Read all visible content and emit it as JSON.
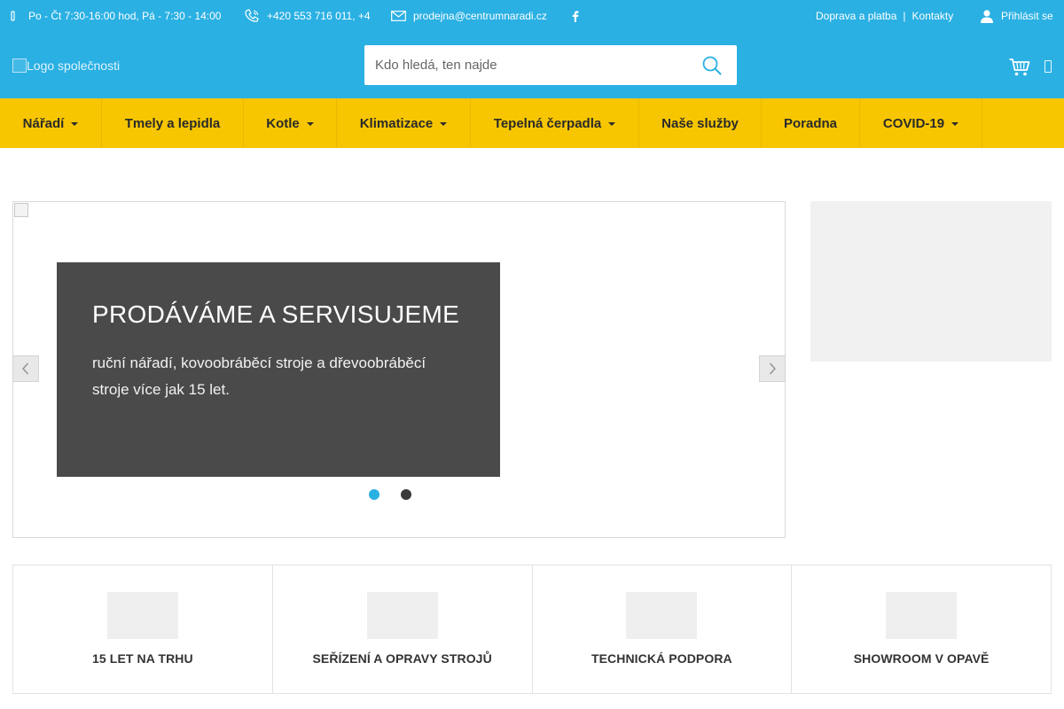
{
  "topbar": {
    "hours": "Po - Čt 7:30-16:00 hod, Pá - 7:30 - 14:00",
    "phone": "+420 553 716 011, +4",
    "email": "prodejna@centrumnaradi.cz",
    "links": {
      "shipping": "Doprava a platba",
      "separator": "|",
      "contacts": "Kontakty"
    },
    "login": "Přihlásit se"
  },
  "header": {
    "logo_alt": "Logo společnosti",
    "search": {
      "placeholder": "Kdo hledá, ten najde",
      "value": ""
    }
  },
  "nav": {
    "items": [
      {
        "label": "Nářadí",
        "dropdown": true
      },
      {
        "label": "Tmely a lepidla",
        "dropdown": false
      },
      {
        "label": "Kotle",
        "dropdown": true
      },
      {
        "label": "Klimatizace",
        "dropdown": true
      },
      {
        "label": "Tepelná čerpadla",
        "dropdown": true
      },
      {
        "label": "Naše služby",
        "dropdown": false
      },
      {
        "label": "Poradna",
        "dropdown": false
      },
      {
        "label": "COVID-19",
        "dropdown": true
      }
    ]
  },
  "slider": {
    "title": "PRODÁVÁME A SERVISUJEME",
    "text": "ruční nářadí, kovoobráběcí stroje a dřevoobráběcí stroje více jak 15 let.",
    "active_slide": 1,
    "slide_count": 2
  },
  "features": [
    {
      "label": "15 let na trhu"
    },
    {
      "label": "Seřízení a opravy strojů"
    },
    {
      "label": "Technická podpora"
    },
    {
      "label": "Showroom v Opavě"
    }
  ],
  "colors": {
    "primary": "#2ab0e3",
    "nav": "#f7c600",
    "caption_bg": "#4a4a4a",
    "dot_active": "#2ab0e3"
  },
  "icons": [
    "clock-icon",
    "phone-icon",
    "mail-icon",
    "facebook-icon",
    "user-icon",
    "search-icon",
    "cart-icon",
    "menu-icon",
    "chevron-left-icon",
    "chevron-right-icon",
    "chevron-down-icon"
  ]
}
